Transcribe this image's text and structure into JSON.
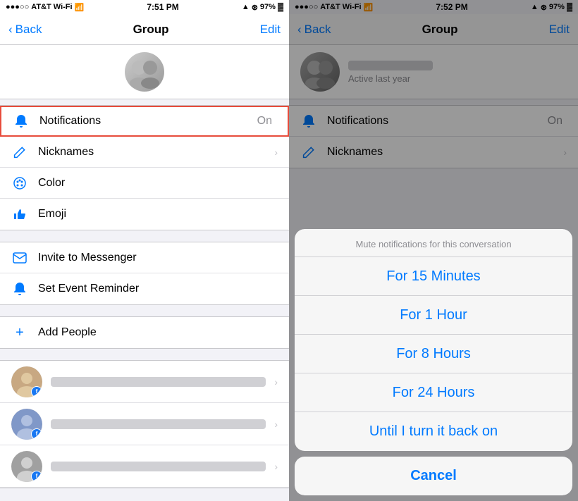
{
  "left": {
    "status": {
      "carrier": "AT&T Wi-Fi",
      "time": "7:51 PM",
      "battery": "97%"
    },
    "nav": {
      "back": "Back",
      "title": "Group",
      "action": "Edit"
    },
    "menu_items": [
      {
        "id": "notifications",
        "icon": "🔔",
        "label": "Notifications",
        "value": "On",
        "chevron": false,
        "highlighted": true
      },
      {
        "id": "nicknames",
        "icon": "✏️",
        "label": "Nicknames",
        "value": "",
        "chevron": true,
        "highlighted": false
      },
      {
        "id": "color",
        "icon": "🎨",
        "label": "Color",
        "value": "",
        "chevron": false,
        "highlighted": false
      },
      {
        "id": "emoji",
        "icon": "👍",
        "label": "Emoji",
        "value": "",
        "chevron": false,
        "highlighted": false
      }
    ],
    "menu_items2": [
      {
        "id": "invite",
        "icon": "✉️",
        "label": "Invite to Messenger",
        "chevron": false
      },
      {
        "id": "reminder",
        "icon": "🔔",
        "label": "Set Event Reminder",
        "chevron": false
      }
    ],
    "menu_items3": [
      {
        "id": "add",
        "icon": "+",
        "label": "Add People",
        "chevron": false
      }
    ]
  },
  "right": {
    "status": {
      "carrier": "AT&T Wi-Fi",
      "time": "7:52 PM",
      "battery": "97%"
    },
    "nav": {
      "back": "Back",
      "title": "Group",
      "action": "Edit"
    },
    "group": {
      "active": "Active last year"
    },
    "notifications_label": "Notifications",
    "notifications_value": "On",
    "nicknames_label": "Nicknames",
    "modal": {
      "title": "Mute notifications for this conversation",
      "options": [
        "For 15 Minutes",
        "For 1 Hour",
        "For 8 Hours",
        "For 24 Hours",
        "Until I turn it back on"
      ],
      "cancel": "Cancel"
    }
  }
}
